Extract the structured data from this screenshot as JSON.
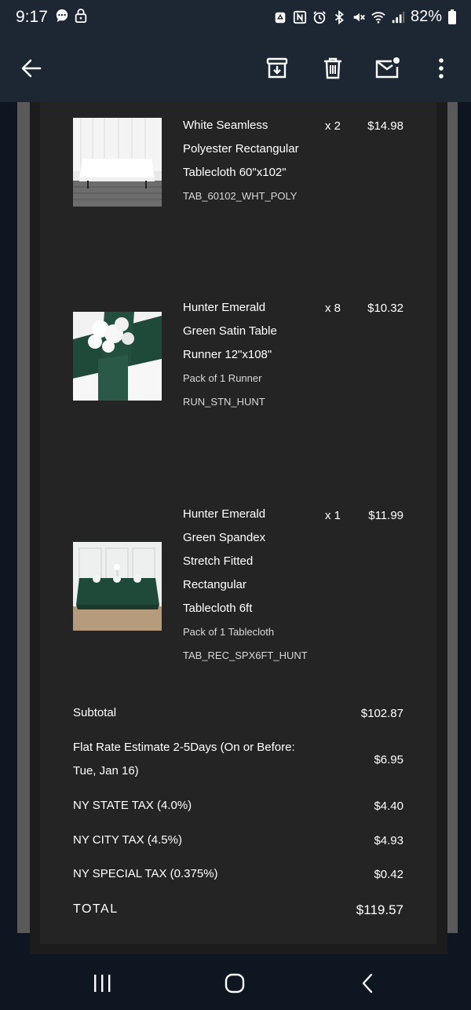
{
  "status": {
    "time": "9:17",
    "battery": "82%",
    "left_icons": [
      "chat-bubble-icon",
      "lock-icon"
    ],
    "right_icons": [
      "recycle-icon",
      "nfc-icon",
      "alarm-icon",
      "bluetooth-icon",
      "mute-icon",
      "wifi-icon",
      "signal-icon",
      "battery-icon"
    ]
  },
  "toolbar": {
    "icons": [
      "back-arrow-icon",
      "archive-icon",
      "trash-icon",
      "mark-unread-icon",
      "more-vert-icon"
    ]
  },
  "items": [
    {
      "name_lines": [
        "White Seamless",
        "Polyester Rectangular",
        "Tablecloth 60\"x102\""
      ],
      "pack": "",
      "sku": "TAB_60102_WHT_POLY",
      "qty": "x 2",
      "price": "$14.98"
    },
    {
      "name_lines": [
        "Hunter Emerald",
        "Green Satin Table",
        "Runner 12\"x108\""
      ],
      "pack": "Pack of 1 Runner",
      "sku": "RUN_STN_HUNT",
      "qty": "x 8",
      "price": "$10.32"
    },
    {
      "name_lines": [
        "Hunter Emerald",
        "Green Spandex",
        "Stretch Fitted",
        "Rectangular",
        "Tablecloth 6ft"
      ],
      "pack": "Pack of 1 Tablecloth",
      "sku": "TAB_REC_SPX6FT_HUNT",
      "qty": "x 1",
      "price": "$11.99"
    }
  ],
  "summary": {
    "subtotal_label": "Subtotal",
    "subtotal_value": "$102.87",
    "shipping_label_1": "Flat Rate Estimate 2-5Days (On or Before:",
    "shipping_label_2": "Tue, Jan 16)",
    "shipping_value": "$6.95",
    "state_tax_label": "NY STATE TAX (4.0%)",
    "state_tax_value": "$4.40",
    "city_tax_label": "NY CITY TAX (4.5%)",
    "city_tax_value": "$4.93",
    "special_tax_label": "NY SPECIAL TAX (0.375%)",
    "special_tax_value": "$0.42",
    "total_label": "TOTAL",
    "total_value": "$119.57"
  },
  "nav": {
    "icons": [
      "recent-apps-icon",
      "home-icon",
      "back-icon"
    ]
  }
}
